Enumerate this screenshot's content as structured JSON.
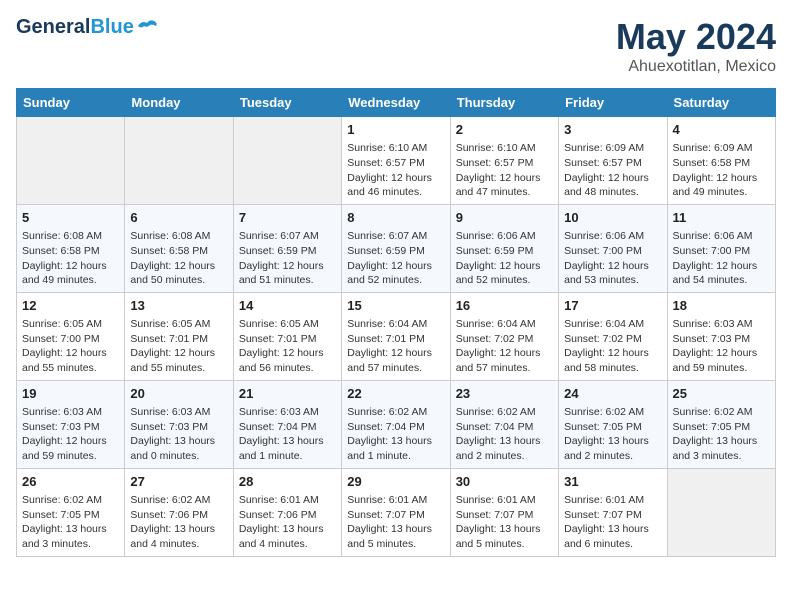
{
  "header": {
    "logo_general": "General",
    "logo_blue": "Blue",
    "title": "May 2024",
    "subtitle": "Ahuexotitlan, Mexico"
  },
  "days_of_week": [
    "Sunday",
    "Monday",
    "Tuesday",
    "Wednesday",
    "Thursday",
    "Friday",
    "Saturday"
  ],
  "weeks": [
    [
      {
        "day": "",
        "info": ""
      },
      {
        "day": "",
        "info": ""
      },
      {
        "day": "",
        "info": ""
      },
      {
        "day": "1",
        "info": "Sunrise: 6:10 AM\nSunset: 6:57 PM\nDaylight: 12 hours\nand 46 minutes."
      },
      {
        "day": "2",
        "info": "Sunrise: 6:10 AM\nSunset: 6:57 PM\nDaylight: 12 hours\nand 47 minutes."
      },
      {
        "day": "3",
        "info": "Sunrise: 6:09 AM\nSunset: 6:57 PM\nDaylight: 12 hours\nand 48 minutes."
      },
      {
        "day": "4",
        "info": "Sunrise: 6:09 AM\nSunset: 6:58 PM\nDaylight: 12 hours\nand 49 minutes."
      }
    ],
    [
      {
        "day": "5",
        "info": "Sunrise: 6:08 AM\nSunset: 6:58 PM\nDaylight: 12 hours\nand 49 minutes."
      },
      {
        "day": "6",
        "info": "Sunrise: 6:08 AM\nSunset: 6:58 PM\nDaylight: 12 hours\nand 50 minutes."
      },
      {
        "day": "7",
        "info": "Sunrise: 6:07 AM\nSunset: 6:59 PM\nDaylight: 12 hours\nand 51 minutes."
      },
      {
        "day": "8",
        "info": "Sunrise: 6:07 AM\nSunset: 6:59 PM\nDaylight: 12 hours\nand 52 minutes."
      },
      {
        "day": "9",
        "info": "Sunrise: 6:06 AM\nSunset: 6:59 PM\nDaylight: 12 hours\nand 52 minutes."
      },
      {
        "day": "10",
        "info": "Sunrise: 6:06 AM\nSunset: 7:00 PM\nDaylight: 12 hours\nand 53 minutes."
      },
      {
        "day": "11",
        "info": "Sunrise: 6:06 AM\nSunset: 7:00 PM\nDaylight: 12 hours\nand 54 minutes."
      }
    ],
    [
      {
        "day": "12",
        "info": "Sunrise: 6:05 AM\nSunset: 7:00 PM\nDaylight: 12 hours\nand 55 minutes."
      },
      {
        "day": "13",
        "info": "Sunrise: 6:05 AM\nSunset: 7:01 PM\nDaylight: 12 hours\nand 55 minutes."
      },
      {
        "day": "14",
        "info": "Sunrise: 6:05 AM\nSunset: 7:01 PM\nDaylight: 12 hours\nand 56 minutes."
      },
      {
        "day": "15",
        "info": "Sunrise: 6:04 AM\nSunset: 7:01 PM\nDaylight: 12 hours\nand 57 minutes."
      },
      {
        "day": "16",
        "info": "Sunrise: 6:04 AM\nSunset: 7:02 PM\nDaylight: 12 hours\nand 57 minutes."
      },
      {
        "day": "17",
        "info": "Sunrise: 6:04 AM\nSunset: 7:02 PM\nDaylight: 12 hours\nand 58 minutes."
      },
      {
        "day": "18",
        "info": "Sunrise: 6:03 AM\nSunset: 7:03 PM\nDaylight: 12 hours\nand 59 minutes."
      }
    ],
    [
      {
        "day": "19",
        "info": "Sunrise: 6:03 AM\nSunset: 7:03 PM\nDaylight: 12 hours\nand 59 minutes."
      },
      {
        "day": "20",
        "info": "Sunrise: 6:03 AM\nSunset: 7:03 PM\nDaylight: 13 hours\nand 0 minutes."
      },
      {
        "day": "21",
        "info": "Sunrise: 6:03 AM\nSunset: 7:04 PM\nDaylight: 13 hours\nand 1 minute."
      },
      {
        "day": "22",
        "info": "Sunrise: 6:02 AM\nSunset: 7:04 PM\nDaylight: 13 hours\nand 1 minute."
      },
      {
        "day": "23",
        "info": "Sunrise: 6:02 AM\nSunset: 7:04 PM\nDaylight: 13 hours\nand 2 minutes."
      },
      {
        "day": "24",
        "info": "Sunrise: 6:02 AM\nSunset: 7:05 PM\nDaylight: 13 hours\nand 2 minutes."
      },
      {
        "day": "25",
        "info": "Sunrise: 6:02 AM\nSunset: 7:05 PM\nDaylight: 13 hours\nand 3 minutes."
      }
    ],
    [
      {
        "day": "26",
        "info": "Sunrise: 6:02 AM\nSunset: 7:05 PM\nDaylight: 13 hours\nand 3 minutes."
      },
      {
        "day": "27",
        "info": "Sunrise: 6:02 AM\nSunset: 7:06 PM\nDaylight: 13 hours\nand 4 minutes."
      },
      {
        "day": "28",
        "info": "Sunrise: 6:01 AM\nSunset: 7:06 PM\nDaylight: 13 hours\nand 4 minutes."
      },
      {
        "day": "29",
        "info": "Sunrise: 6:01 AM\nSunset: 7:07 PM\nDaylight: 13 hours\nand 5 minutes."
      },
      {
        "day": "30",
        "info": "Sunrise: 6:01 AM\nSunset: 7:07 PM\nDaylight: 13 hours\nand 5 minutes."
      },
      {
        "day": "31",
        "info": "Sunrise: 6:01 AM\nSunset: 7:07 PM\nDaylight: 13 hours\nand 6 minutes."
      },
      {
        "day": "",
        "info": ""
      }
    ]
  ]
}
